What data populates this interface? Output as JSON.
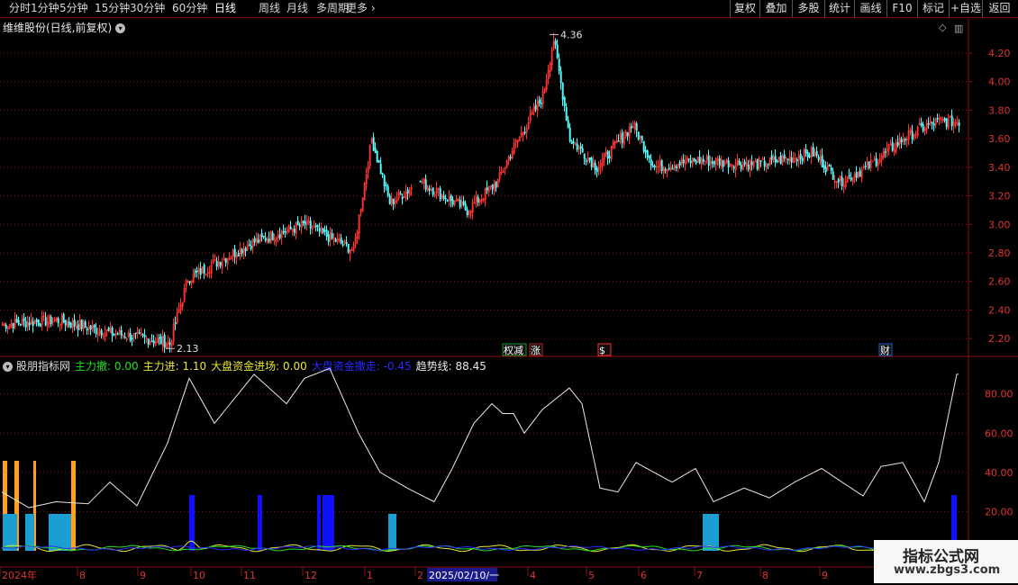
{
  "toolbar": {
    "timeframes": [
      {
        "label": "分时",
        "active": false
      },
      {
        "label": "1分钟",
        "active": false
      },
      {
        "label": "5分钟",
        "active": false
      },
      {
        "label": "15分钟",
        "active": false
      },
      {
        "label": "30分钟",
        "active": false
      },
      {
        "label": "60分钟",
        "active": false
      },
      {
        "label": "日线",
        "active": true
      },
      {
        "label": "周线",
        "active": false
      },
      {
        "label": "月线",
        "active": false
      },
      {
        "label": "多周期",
        "active": false
      },
      {
        "label": "更多",
        "active": false
      }
    ],
    "buttons": [
      "复权",
      "叠加",
      "多股",
      "统计",
      "画线",
      "F10",
      "标记",
      "+自选",
      "返回"
    ]
  },
  "price_panel": {
    "title": "维维股份(日线,前复权)",
    "high_label": "4.36",
    "low_label": "2.13",
    "ylim": [
      2.1,
      4.32
    ],
    "ticks": [
      "4.20",
      "4.00",
      "3.80",
      "3.60",
      "3.40",
      "3.20",
      "3.00",
      "2.80",
      "2.60",
      "2.40",
      "2.20"
    ],
    "markers": [
      {
        "text": "权减",
        "color": "#1a8f2a",
        "bar": 281
      },
      {
        "text": "涨",
        "color": "#b52020",
        "bar": 296
      },
      {
        "text": "$",
        "color": "#ff2a2a",
        "bar": 334
      },
      {
        "text": "财",
        "color": "#1a5fd0",
        "bar": 490
      }
    ]
  },
  "indicator_panel": {
    "name": "股朋指标网",
    "lines": [
      {
        "label": "主力撤:",
        "value": "0.00",
        "color": "#22e022"
      },
      {
        "label": "主力进:",
        "value": "1.10",
        "color": "#e8e830"
      },
      {
        "label": "大盘资金进场:",
        "value": "0.00",
        "color": "#e8e830"
      },
      {
        "label": "大盘资金撤走:",
        "value": "-0.45",
        "color": "#2a2aff"
      },
      {
        "label": "趋势线:",
        "value": "88.45",
        "color": "#e8e8e8"
      }
    ],
    "ticks": [
      "80.00",
      "60.00",
      "40.00",
      "20.00"
    ]
  },
  "x_axis": {
    "labels": [
      "2024年",
      "8",
      "9",
      "10",
      "11",
      "12",
      "1",
      "2",
      "2025/02/10/一",
      "4",
      "5",
      "6",
      "7",
      "8",
      "9"
    ]
  },
  "logo": {
    "line1": "指标公式网",
    "line2": "www.zbgs3.com"
  },
  "chart_data": [
    {
      "type": "candlestick",
      "title": "维维股份(日线,前复权)",
      "x_range": [
        "2024-07",
        "2025-09"
      ],
      "ylim": [
        2.1,
        4.32
      ],
      "annotations": [
        {
          "text": "4.36",
          "kind": "high"
        },
        {
          "text": "2.13",
          "kind": "low"
        }
      ],
      "series": [
        {
          "name": "price",
          "x_index": [
            0,
            30,
            60,
            93,
            103,
            140,
            168,
            195,
            205,
            215,
            232,
            258,
            275,
            282,
            300,
            306,
            315,
            330,
            350,
            362,
            385,
            420,
            450,
            465,
            480,
            500,
            514,
            520
          ],
          "values": [
            2.3,
            2.33,
            2.24,
            2.17,
            2.62,
            2.88,
            3.0,
            2.82,
            3.6,
            3.15,
            3.3,
            3.1,
            3.3,
            3.5,
            3.9,
            4.3,
            3.6,
            3.4,
            3.7,
            3.4,
            3.45,
            3.42,
            3.5,
            3.3,
            3.4,
            3.6,
            3.7,
            3.72
          ]
        }
      ]
    },
    {
      "type": "line",
      "title": "股朋指标网",
      "ylim": [
        0,
        95
      ],
      "series": [
        {
          "name": "趋势线",
          "x_index": [
            0,
            15,
            30,
            48,
            60,
            75,
            92,
            104,
            118,
            140,
            158,
            168,
            182,
            198,
            210,
            225,
            240,
            250,
            262,
            272,
            278,
            284,
            290,
            300,
            315,
            322,
            332,
            342,
            352,
            372,
            385,
            395,
            412,
            426,
            440,
            455,
            468,
            478,
            488,
            500,
            512,
            520,
            530
          ],
          "values": [
            30,
            22,
            25,
            24,
            35,
            23,
            55,
            88,
            65,
            90,
            75,
            88,
            93,
            60,
            40,
            32,
            25,
            42,
            65,
            75,
            70,
            70,
            60,
            72,
            83,
            75,
            32,
            30,
            45,
            35,
            42,
            25,
            32,
            27,
            35,
            42,
            34,
            28,
            43,
            45,
            25,
            45,
            90
          ]
        },
        {
          "name": "主力撤",
          "values_note": "near zero"
        },
        {
          "name": "主力进",
          "values_note": "near zero"
        }
      ]
    }
  ]
}
